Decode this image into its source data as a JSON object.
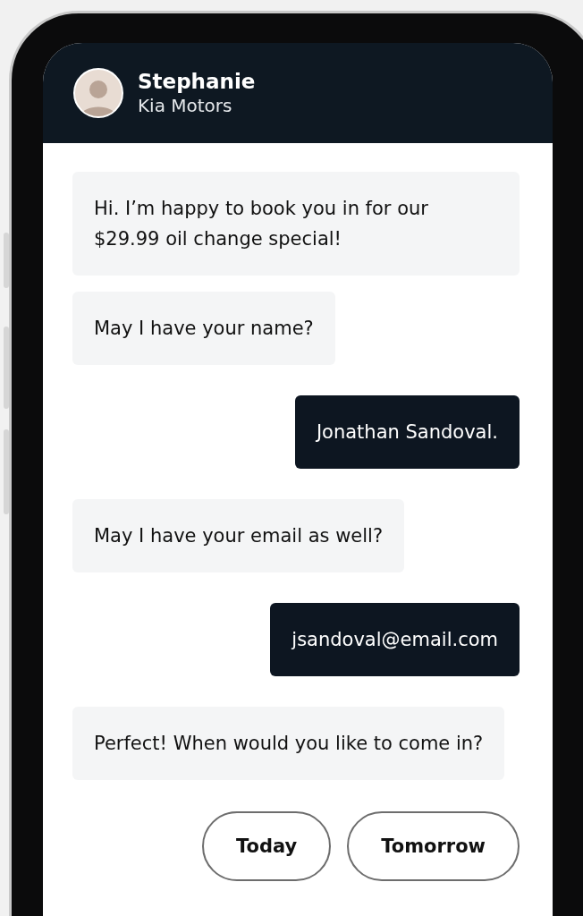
{
  "contact": {
    "name": "Stephanie",
    "company": "Kia Motors"
  },
  "messages": [
    {
      "kind": "incoming",
      "text": "Hi. I’m happy to book you in for our $29.99 oil change special!"
    },
    {
      "kind": "incoming",
      "text": "May I have your name?"
    },
    {
      "kind": "outgoing",
      "text": "Jonathan Sandoval."
    },
    {
      "kind": "incoming",
      "text": "May I have your email as well?"
    },
    {
      "kind": "outgoing",
      "text": "jsandoval@email.com"
    },
    {
      "kind": "incoming",
      "text": "Perfect! When would you like to come in?"
    }
  ],
  "quick_replies": [
    "Today",
    "Tomorrow"
  ]
}
